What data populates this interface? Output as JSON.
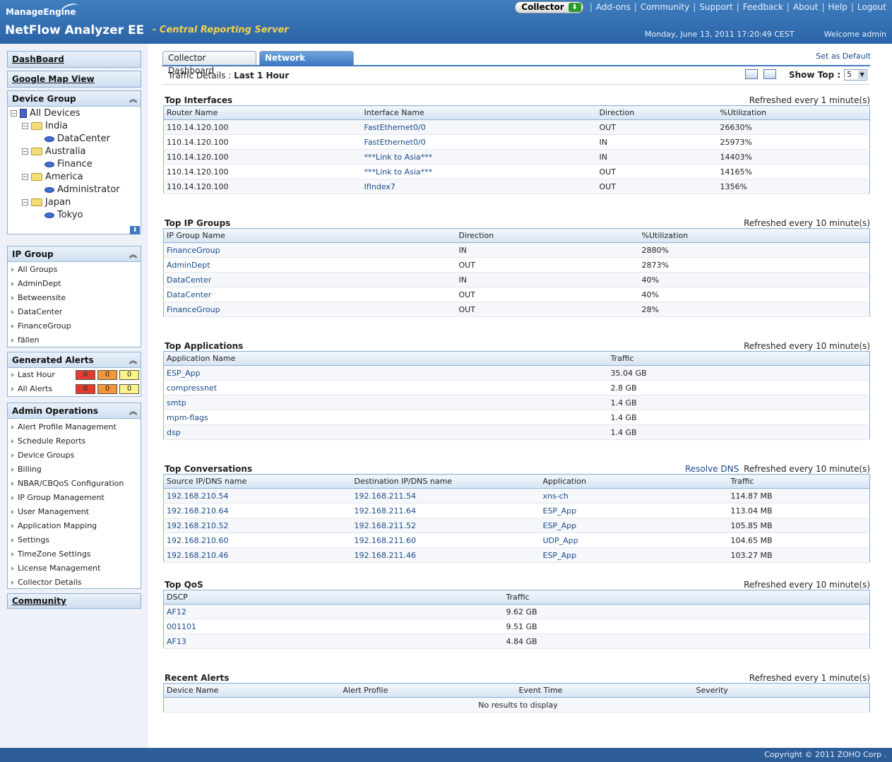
{
  "header": {
    "brand_top": "ManageEngine",
    "brand_main": "NetFlow Analyzer EE",
    "brand_sub": "- Central Reporting Server",
    "collector_label": "Collector",
    "nav": [
      "Add-ons",
      "Community",
      "Support",
      "Feedback",
      "About",
      "Help",
      "Logout"
    ],
    "datetime": "Monday, June 13, 2011 17:20:49 CEST",
    "welcome": "Welcome admin"
  },
  "sidebar": {
    "dashboard": "DashBoard",
    "google_map": "Google Map View",
    "device_group": {
      "title": "Device Group",
      "nodes": [
        {
          "label": "All Devices",
          "level": 0,
          "icon": "server-icon"
        },
        {
          "label": "India",
          "level": 1,
          "icon": "folder-icon"
        },
        {
          "label": "DataCenter",
          "level": 2,
          "icon": "router-icon"
        },
        {
          "label": "Australia",
          "level": 1,
          "icon": "folder-icon"
        },
        {
          "label": "Finance",
          "level": 2,
          "icon": "router-icon"
        },
        {
          "label": "America",
          "level": 1,
          "icon": "folder-icon"
        },
        {
          "label": "Administrator",
          "level": 2,
          "icon": "router-icon"
        },
        {
          "label": "Japan",
          "level": 1,
          "icon": "folder-icon"
        },
        {
          "label": "Tokyo",
          "level": 2,
          "icon": "router-icon"
        }
      ]
    },
    "ip_group": {
      "title": "IP Group",
      "items": [
        "All Groups",
        "AdminDept",
        "Betweensite",
        "DataCenter",
        "FinanceGroup",
        "fällen"
      ]
    },
    "alerts": {
      "title": "Generated Alerts",
      "rows": [
        {
          "label": "Last Hour",
          "counts": [
            "0",
            "0",
            "0"
          ]
        },
        {
          "label": "All Alerts",
          "counts": [
            "0",
            "0",
            "0"
          ]
        }
      ]
    },
    "admin": {
      "title": "Admin Operations",
      "items": [
        "Alert Profile Management",
        "Schedule Reports",
        "Device Groups",
        "Billing",
        "NBAR/CBQoS Configuration",
        "IP Group Management",
        "User Management",
        "Application Mapping",
        "Settings",
        "TimeZone Settings",
        "License Management",
        "Collector Details"
      ]
    },
    "community": "Community"
  },
  "main": {
    "tabs": [
      "Collector Dashboard",
      "Network Snapshot"
    ],
    "set_default": "Set as Default",
    "traffic_label": "Traffic Details :",
    "traffic_period": "Last 1 Hour",
    "show_top_label": "Show Top :",
    "show_top_value": "5",
    "sections": {
      "interfaces": {
        "title": "Top Interfaces",
        "refresh": "Refreshed every 1 minute(s)",
        "headers": [
          "Router Name",
          "Interface Name",
          "Direction",
          "%Utilization"
        ],
        "rows": [
          [
            "110.14.120.100",
            "FastEthernet0/0",
            "OUT",
            "26630%"
          ],
          [
            "110.14.120.100",
            "FastEthernet0/0",
            "IN",
            "25973%"
          ],
          [
            "110.14.120.100",
            "***Link to Asia***",
            "IN",
            "14403%"
          ],
          [
            "110.14.120.100",
            "***Link to Asia***",
            "OUT",
            "14165%"
          ],
          [
            "110.14.120.100",
            "IfIndex7",
            "OUT",
            "1356%"
          ]
        ]
      },
      "ipgroups": {
        "title": "Top IP Groups",
        "refresh": "Refreshed every 10 minute(s)",
        "headers": [
          "IP Group Name",
          "Direction",
          "%Utilization"
        ],
        "rows": [
          [
            "FinanceGroup",
            "IN",
            "2880%"
          ],
          [
            "AdminDept",
            "OUT",
            "2873%"
          ],
          [
            "DataCenter",
            "IN",
            "40%"
          ],
          [
            "DataCenter",
            "OUT",
            "40%"
          ],
          [
            "FinanceGroup",
            "OUT",
            "28%"
          ]
        ]
      },
      "applications": {
        "title": "Top Applications",
        "refresh": "Refreshed every 10 minute(s)",
        "headers": [
          "Application Name",
          "Traffic"
        ],
        "rows": [
          [
            "ESP_App",
            "35.04 GB"
          ],
          [
            "compressnet",
            "2.8 GB"
          ],
          [
            "smtp",
            "1.4 GB"
          ],
          [
            "mpm-flags",
            "1.4 GB"
          ],
          [
            "dsp",
            "1.4 GB"
          ]
        ]
      },
      "conversations": {
        "title": "Top Conversations",
        "resolve_dns": "Resolve DNS",
        "refresh": "Refreshed every 10 minute(s)",
        "headers": [
          "Source IP/DNS name",
          "Destination IP/DNS name",
          "Application",
          "Traffic"
        ],
        "rows": [
          [
            "192.168.210.54",
            "192.168.211.54",
            "xns-ch",
            "114.87 MB"
          ],
          [
            "192.168.210.64",
            "192.168.211.64",
            "ESP_App",
            "113.04 MB"
          ],
          [
            "192.168.210.52",
            "192.168.211.52",
            "ESP_App",
            "105.85 MB"
          ],
          [
            "192.168.210.60",
            "192.168.211.60",
            "UDP_App",
            "104.65 MB"
          ],
          [
            "192.168.210.46",
            "192.168.211.46",
            "ESP_App",
            "103.27 MB"
          ]
        ]
      },
      "qos": {
        "title": "Top QoS",
        "refresh": "Refreshed every 10 minute(s)",
        "headers": [
          "DSCP",
          "Traffic"
        ],
        "rows": [
          [
            "AF12",
            "9.62 GB"
          ],
          [
            "001101",
            "9.51 GB"
          ],
          [
            "AF13",
            "4.84 GB"
          ]
        ]
      },
      "alerts": {
        "title": "Recent Alerts",
        "refresh": "Refreshed every 1 minute(s)",
        "headers": [
          "Device Name",
          "Alert Profile",
          "Event Time",
          "Severity"
        ],
        "empty": "No results to display"
      }
    }
  },
  "footer": {
    "copyright": "Copyright © 2011 ZOHO Corp ."
  },
  "colors": {
    "header_bg": "#2a64a6",
    "brand_sub": "#f4d24a",
    "alert_critical": "#e23b2f",
    "alert_major": "#f2963a",
    "alert_warning": "#faf38a"
  }
}
